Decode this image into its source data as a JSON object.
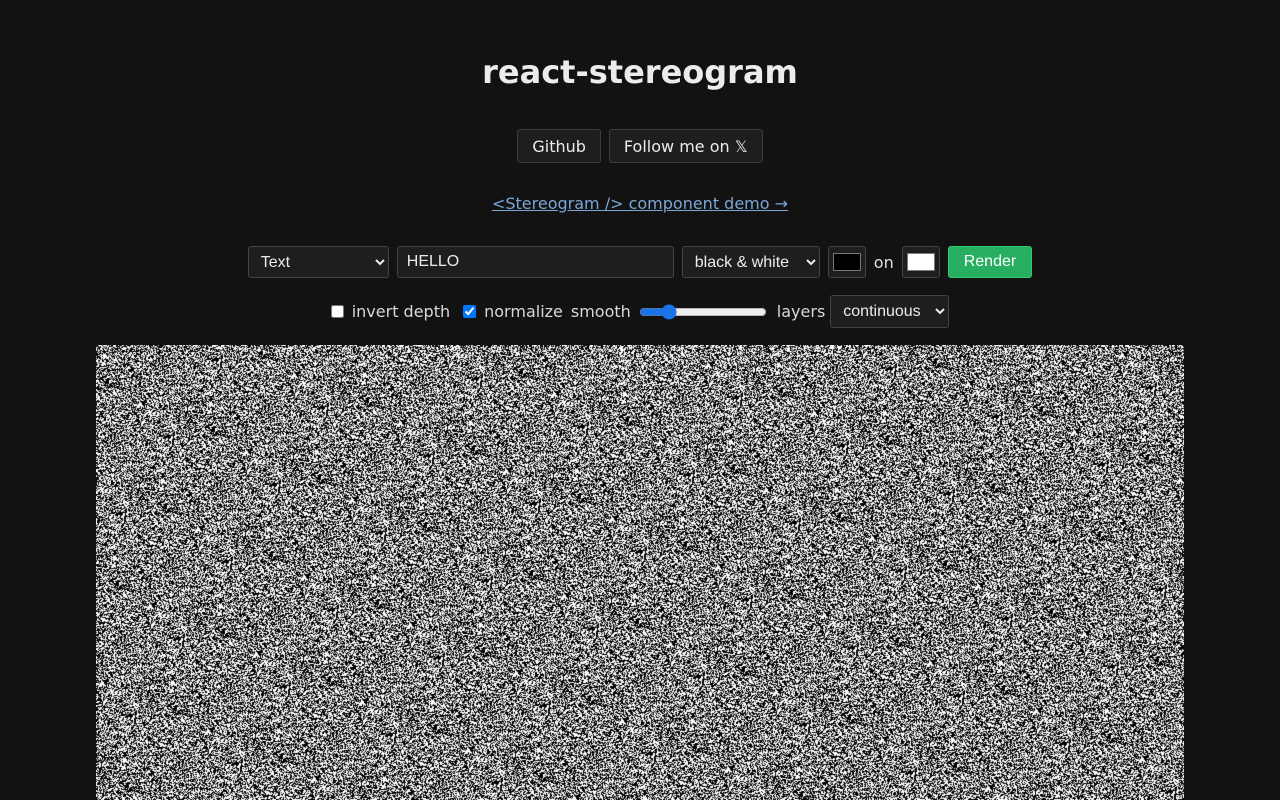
{
  "header": {
    "title": "react-stereogram"
  },
  "links": {
    "github_label": "Github",
    "follow_label": "Follow me on 𝕏",
    "demo_label": "<Stereogram /> component demo →"
  },
  "controls": {
    "source_type": "Text",
    "text_value": "HELLO",
    "color_mode": "black & white",
    "foreground_color": "#000000",
    "on_label": "on",
    "background_color": "#ffffff",
    "render_label": "Render"
  },
  "options": {
    "invert_depth_label": "invert depth",
    "invert_depth_checked": false,
    "normalize_label": "normalize",
    "normalize_checked": true,
    "smooth_label": "smooth",
    "smooth_value": 0.2,
    "layers_label": "layers",
    "layers_value": "continuous"
  },
  "colors": {
    "background": "#121212",
    "accent_green": "#27ae60",
    "link": "#7aa6d8"
  }
}
